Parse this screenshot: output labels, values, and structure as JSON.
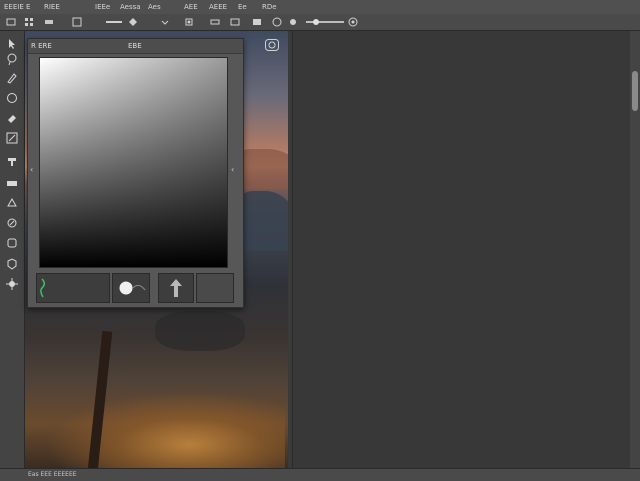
{
  "menubar": {
    "items": [
      "EEEIE",
      "E",
      "RIEE",
      "IEEe",
      "Aessa",
      "Aes",
      "AEE",
      "AEEE",
      "Ee",
      "RDe"
    ]
  },
  "panel": {
    "title": "R ERE",
    "subtitle": "EBE"
  },
  "statusbar": {
    "text": "Eas  EEE  EEEEEE"
  },
  "icons": {
    "tools": [
      "arrow-icon",
      "lasso-icon",
      "brush-icon",
      "circle-icon",
      "eraser-icon",
      "gradient-icon",
      "stamp-icon",
      "eye-icon",
      "pen-icon",
      "text-icon",
      "shape-icon",
      "hand-icon",
      "zoom-icon"
    ],
    "panel": [
      "eyedropper-icon",
      "circle-swatch-icon",
      "arrow-up-icon"
    ]
  },
  "colors": {
    "picker_white": "#ffffff",
    "picker_black": "#000000",
    "accent_green": "#3fbf5f"
  }
}
